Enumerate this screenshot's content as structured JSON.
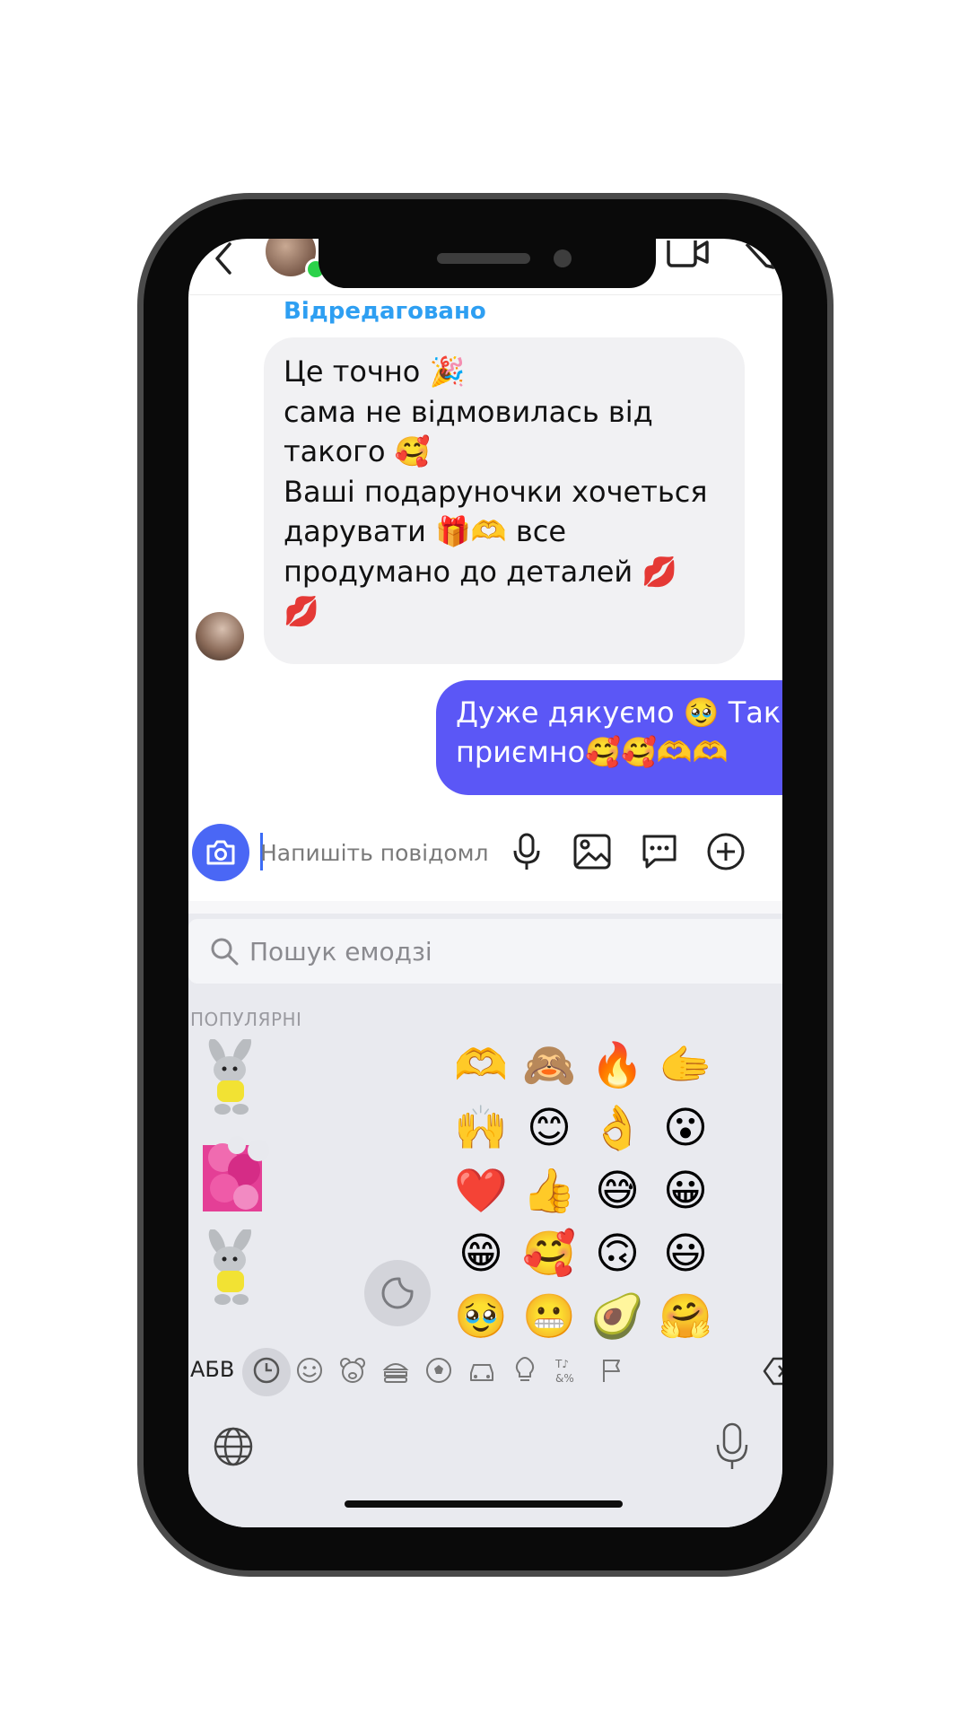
{
  "header": {
    "back_icon": "chevron-left-icon",
    "video_icon": "video-call-icon",
    "edit_icon": "edit-icon"
  },
  "chat": {
    "edited_label": "Відредаговано",
    "incoming_lines": [
      "Це точно 🎉",
      "сама не відмовилась від",
      "такого 🥰",
      "Ваші подаруночки хочеться",
      "дарувати 🎁🫶 все",
      "продумано до деталей 💋",
      "💋"
    ],
    "outgoing_lines": [
      "Дуже дякуємо 🥹 Так",
      "приємно🥰🥰🫶🫶"
    ]
  },
  "composer": {
    "placeholder": "Напишіть повідомле..."
  },
  "keyboard": {
    "search_placeholder": "Пошук емодзі",
    "section_label": "ПОПУЛЯРНІ",
    "abc_key": "АБВ",
    "emoji_grid": [
      [
        "🫶",
        "🙈",
        "🔥",
        "🫱"
      ],
      [
        "🙌",
        "😊",
        "👌",
        "😮"
      ],
      [
        "❤️",
        "👍",
        "😅",
        "😀"
      ],
      [
        "😁",
        "🥰",
        "🙃",
        "😃"
      ],
      [
        "🥹",
        "😬",
        "🥑",
        "🤗"
      ]
    ],
    "categories": [
      "recent",
      "smileys",
      "animals",
      "food",
      "activity",
      "travel",
      "objects",
      "symbols",
      "flags"
    ]
  },
  "colors": {
    "outgoing_bubble": "#5b57f6",
    "incoming_bubble": "#f1f1f3",
    "edited_label": "#2e9ff2",
    "camera_button": "#4a67f5",
    "keyboard_bg": "#e9eaef"
  }
}
